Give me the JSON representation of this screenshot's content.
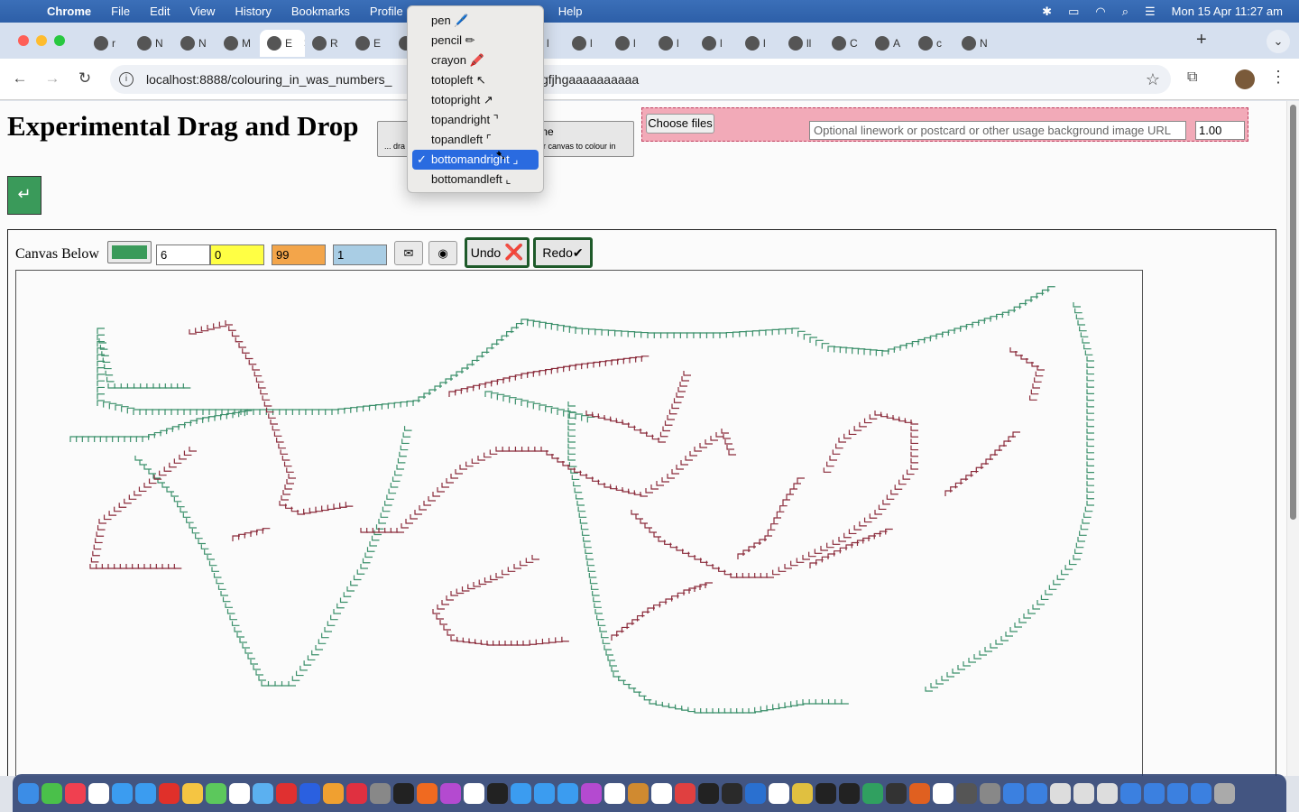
{
  "menubar": {
    "app": "Chrome",
    "items": [
      "File",
      "Edit",
      "View",
      "History",
      "Bookmarks",
      "Profile",
      "Help"
    ],
    "datetime": "Mon 15 Apr  11:27 am"
  },
  "tabs": [
    "r",
    "N",
    "N",
    "M",
    "E",
    "R",
    "E",
    "c",
    "c",
    "l",
    "l",
    "l",
    "l",
    "l",
    "l",
    "l",
    "ll",
    "C",
    "A",
    "c",
    "N"
  ],
  "active_tab_index": 4,
  "address": {
    "url_start": "localhost:8888/colouring_in_was_numbers_",
    "url_end": "gfjhgaaaaaaaaaa"
  },
  "page": {
    "title": "Experimental Drag and Drop",
    "drag_button": {
      "line1": "me",
      "line2_left": "... dra",
      "line2_right": "er canvas to colour in"
    },
    "choose_files": "Choose files",
    "bg_url_placeholder": "Optional linework or postcard or other usage background image URL",
    "opacity_value": "1.00",
    "enter_button": "↵"
  },
  "canvas_toolbar": {
    "label": "Canvas Below",
    "swatch_color": "#3a9a5a",
    "size_value": "6",
    "yellow_value": "0",
    "orange_value": "99",
    "blue_value": "1",
    "undo_label": "Undo",
    "undo_icon": "❌",
    "redo_label": "Redo",
    "redo_icon": "✔"
  },
  "brush_menu": {
    "items": [
      "pen 🖊️",
      "pencil ✏",
      "crayon 🖍️",
      "totopleft ↖",
      "totopright ↗",
      "topandright ⌝",
      "topandleft ⌜",
      "bottomandright ⌟",
      "bottomandleft ⌞"
    ],
    "selected": "bottomandright ⌟"
  },
  "drawing_colors": {
    "green": "#3a8f6a",
    "maroon": "#8a2a3a"
  }
}
